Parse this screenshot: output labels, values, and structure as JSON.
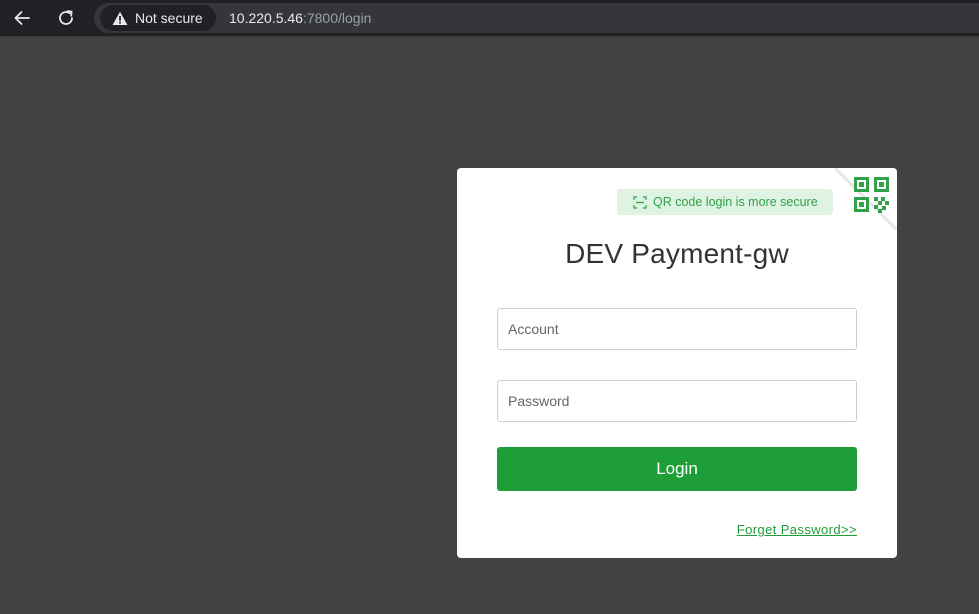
{
  "browser": {
    "security_label": "Not secure",
    "url_host": "10.220.5.46",
    "url_rest": ":7800/login",
    "icons": {
      "back": "arrow-left-icon",
      "reload": "reload-icon",
      "warning": "warning-triangle-icon"
    }
  },
  "login": {
    "qr_tip": "QR code login is more secure",
    "title": "DEV Payment-gw",
    "account_placeholder": "Account",
    "account_value": "",
    "password_placeholder": "Password",
    "password_value": "",
    "login_label": "Login",
    "forget_label": "Forget Password>>",
    "icons": {
      "scan": "scan-icon",
      "qr": "qr-code-icon"
    }
  },
  "colors": {
    "page_background": "#424242",
    "accent_green": "#1e9e38",
    "tip_background": "#dff3e3"
  }
}
